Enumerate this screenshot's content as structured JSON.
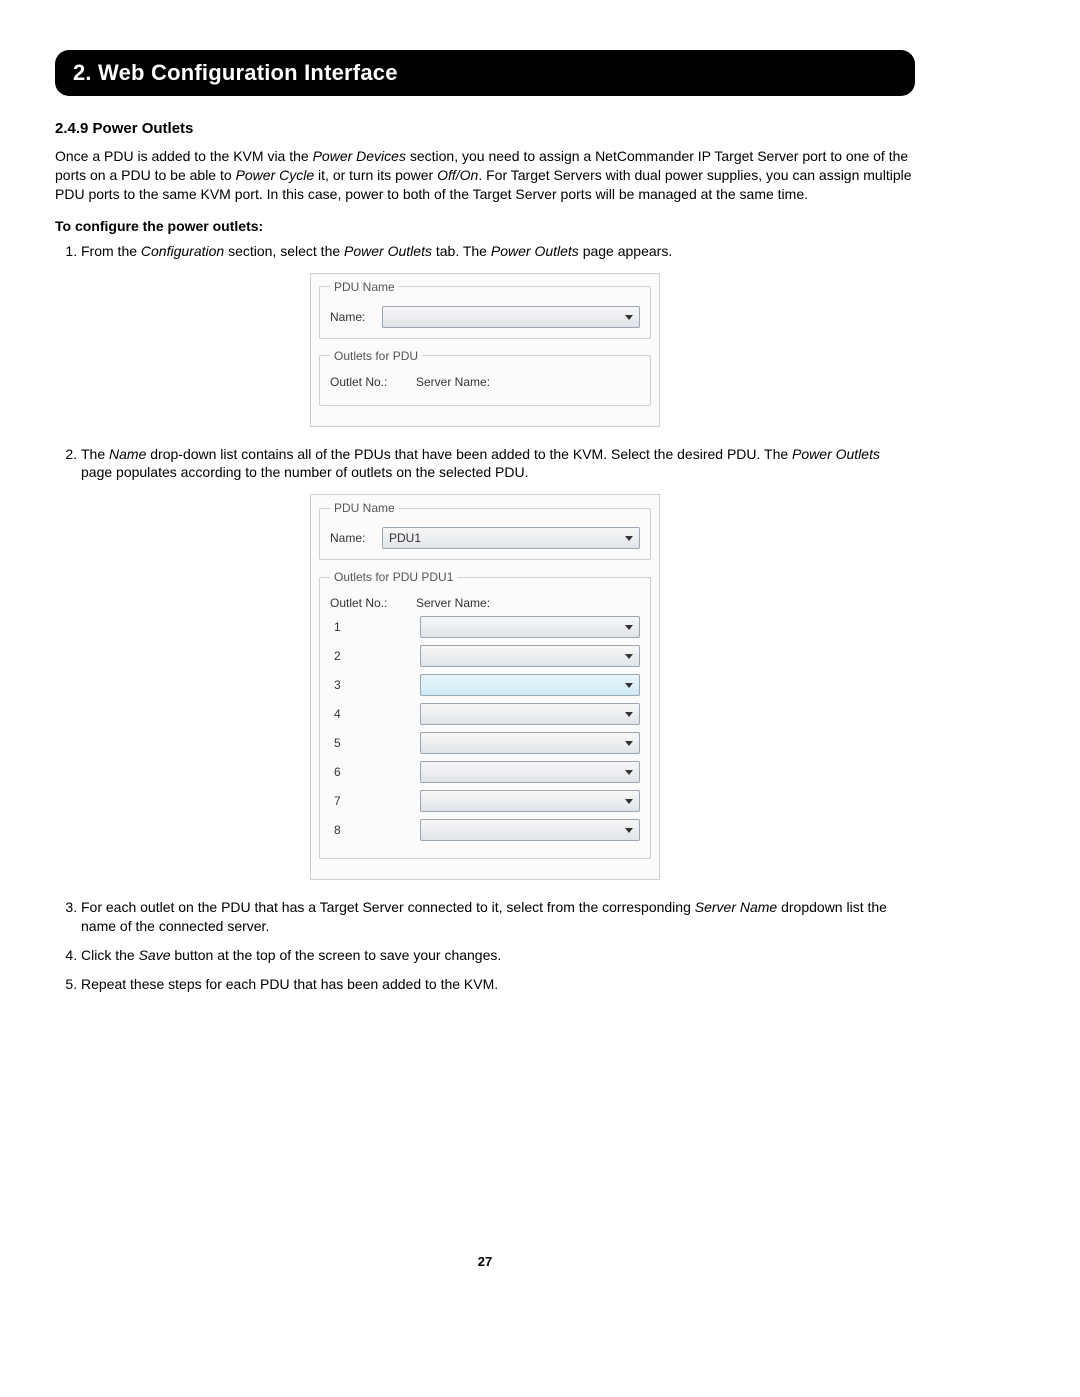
{
  "header": {
    "chapter_title": "2. Web Configuration Interface"
  },
  "section": {
    "number_title": "2.4.9 Power Outlets"
  },
  "intro_para": {
    "pre1": "Once a PDU is added to the KVM via the ",
    "it1": "Power Devices",
    "mid1": " section, you need to assign a NetCommander IP Target Server port to one of the ports on a PDU to be able to ",
    "it2": "Power Cycle",
    "mid2": " it, or turn its power ",
    "it3": "Off/On",
    "post1": ". For Target Servers with dual power supplies, you can assign multiple PDU ports to the same KVM port. In this case, power to both of the Target Server ports will be managed at the same time."
  },
  "configure_heading": "To configure the power outlets:",
  "step1": {
    "pre": "From the ",
    "it1": "Configuration",
    "mid1": " section, select the ",
    "it2": "Power Outlets",
    "mid2": " tab. The ",
    "it3": "Power Outlets",
    "post": " page appears."
  },
  "panel1": {
    "legend_pdu_name": "PDU Name",
    "name_label": "Name:",
    "name_value": "",
    "legend_outlets": "Outlets for PDU",
    "col_outlet": "Outlet No.:",
    "col_server": "Server Name:"
  },
  "step2": {
    "pre": "The ",
    "it1": "Name",
    "mid1": " drop-down list contains all of the PDUs that have been added to the KVM. Select the desired PDU. The ",
    "it2": "Power Outlets",
    "post": " page populates according to the number of outlets on the selected PDU."
  },
  "panel2": {
    "legend_pdu_name": "PDU Name",
    "name_label": "Name:",
    "name_value": "PDU1",
    "legend_outlets": "Outlets for PDU PDU1",
    "col_outlet": "Outlet No.:",
    "col_server": "Server Name:",
    "rows": [
      "1",
      "2",
      "3",
      "4",
      "5",
      "6",
      "7",
      "8"
    ]
  },
  "step3": {
    "pre": "For each outlet on the PDU that has a Target Server connected to it, select from the corresponding ",
    "it1": "Server Name",
    "post": " dropdown list the name of the connected server."
  },
  "step4": {
    "pre": "Click the ",
    "it1": "Save",
    "post": " button at the top of the screen to save your changes."
  },
  "step5": {
    "text": "Repeat these steps for each PDU that has been added to the KVM."
  },
  "page_number": "27"
}
